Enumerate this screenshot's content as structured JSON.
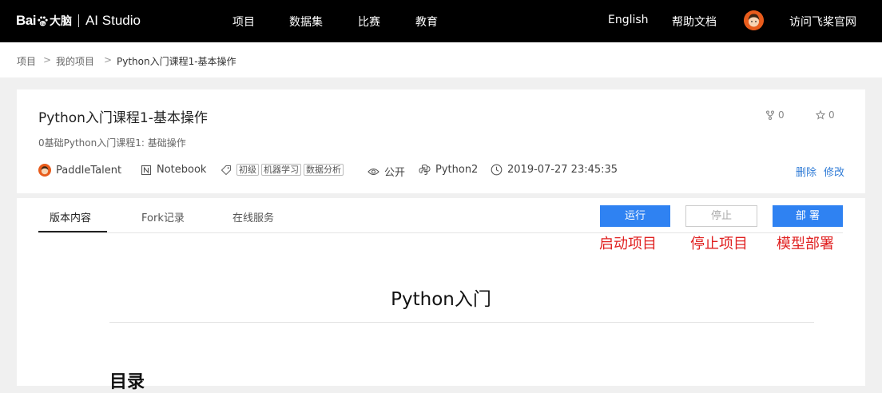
{
  "topbar": {
    "logo": {
      "bai": "Bai",
      "dunao": "大脑",
      "studio": "AI Studio"
    },
    "nav": [
      "项目",
      "数据集",
      "比赛",
      "教育"
    ],
    "english": "English",
    "help": "帮助文档",
    "visit": "访问飞桨官网"
  },
  "breadcrumb": {
    "items": [
      "项目",
      "我的项目",
      "Python入门课程1-基本操作"
    ],
    "separator": ">"
  },
  "project": {
    "title": "Python入门课程1-基本操作",
    "description": "0基础Python入门课程1: 基础操作",
    "fork_count": "0",
    "star_count": "0",
    "owner": "PaddleTalent",
    "type": "Notebook",
    "tags": [
      "初级",
      "机器学习",
      "数据分析"
    ],
    "visibility": "公开",
    "language": "Python2",
    "timestamp": "2019-07-27 23:45:35",
    "delete": "删除",
    "edit": "修改"
  },
  "tabs": [
    "版本内容",
    "Fork记录",
    "在线服务"
  ],
  "buttons": {
    "run": "运行",
    "stop": "停止",
    "deploy": "部 署"
  },
  "annotations": {
    "run": "启动项目",
    "stop": "停止项目",
    "deploy": "模型部署"
  },
  "document": {
    "title": "Python入门",
    "heading": "目录"
  },
  "colors": {
    "accent": "#2f82f2",
    "link": "#2f7bd6",
    "annotation": "#e02020",
    "topbar": "#000000"
  }
}
